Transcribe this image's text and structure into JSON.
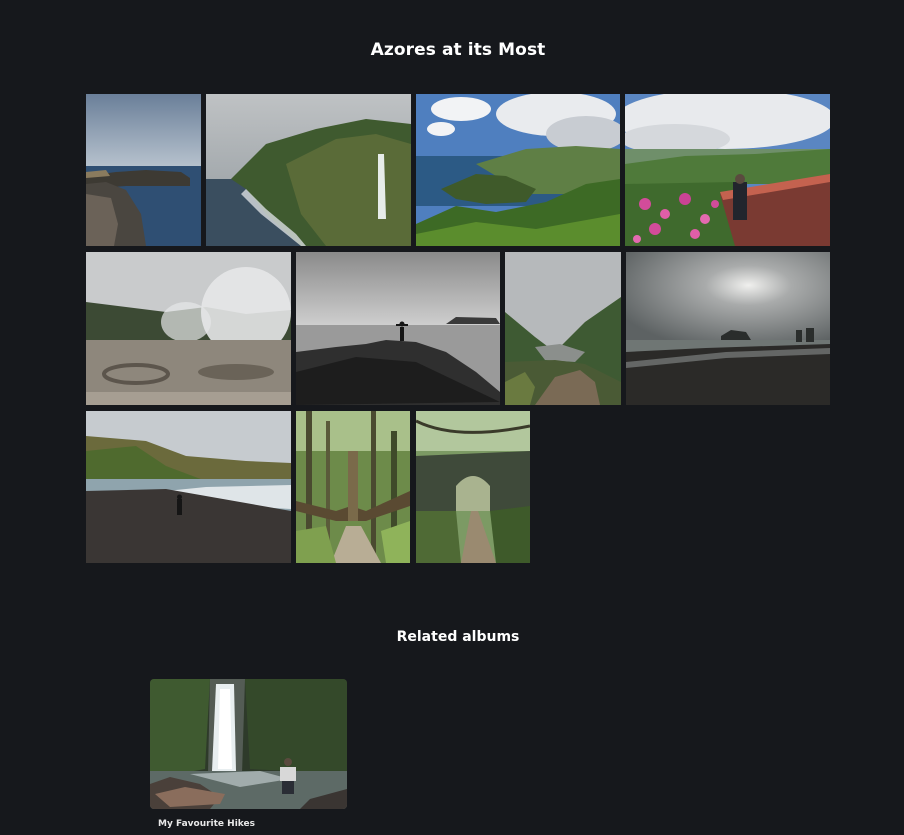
{
  "album": {
    "title": "Azores at its Most",
    "photos": [
      {
        "name": "photo-coastal-cliffs-sea"
      },
      {
        "name": "photo-waterfall-cliff"
      },
      {
        "name": "photo-green-bay-view"
      },
      {
        "name": "photo-viewpoint-flowers"
      },
      {
        "name": "photo-steaming-fumaroles"
      },
      {
        "name": "photo-man-on-rock-bw"
      },
      {
        "name": "photo-valley-path"
      },
      {
        "name": "photo-black-sand-sunset"
      },
      {
        "name": "photo-black-sand-beach-person"
      },
      {
        "name": "photo-forest-stairs"
      },
      {
        "name": "photo-stone-arch-bridge"
      }
    ]
  },
  "related": {
    "heading": "Related albums",
    "albums": [
      {
        "title": "My Favourite Hikes"
      }
    ]
  }
}
